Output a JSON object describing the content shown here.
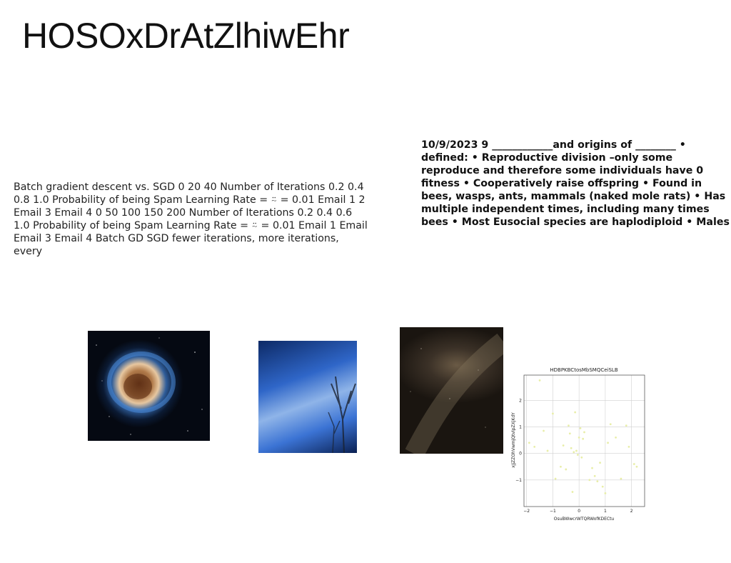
{
  "page": {
    "title": "HOSOxDrAtZlhiwEhr",
    "left_text": "Batch gradient descent vs. SGD 0 20 40 Number of Iterations 0.2 0.4 0.8 1.0 Probability of being Spam Learning Rate = ⍨ = 0.01 Email 1 2 Email 3 Email 4 0 50 100 150 200 Number of Iterations 0.2 0.4 0.6 1.0 Probability of being Spam Learning Rate = ⍨ = 0.01 Email 1 Email Email 3 Email 4 Batch GD SGD fewer iterations, more iterations, every",
    "right_text": "10/9/2023 9 ____________and origins of ________ •\ndefined: • Reproductive division –only some\nreproduce and therefore some individuals have 0\nfitness • Cooperatively raise offspring • Found in\nbees, wasps, ants, mammals (naked mole rats) • Has\nmultiple independent times, including many times\nbees • Most Eusocial species are haplodiploid • Males"
  },
  "chart_data": {
    "type": "scatter",
    "title": "HDBPKBCtosMbSMQCeiSLB",
    "xlabel": "OsuBWwcrWTQRWofKDECtu",
    "ylabel": "xJjZZOhVwmjQtvlpZXjKdY",
    "xlim": [
      -2.1,
      2.5
    ],
    "ylim": [
      -2.0,
      2.95
    ],
    "xticks": [
      -2,
      -1,
      0,
      1,
      2
    ],
    "yticks": [
      -1,
      0,
      1,
      2
    ],
    "grid": true,
    "point_color": "#e8eea8",
    "x": [
      -1.9,
      -1.7,
      -1.5,
      -1.35,
      -1.2,
      -1.0,
      -0.9,
      -0.7,
      -0.6,
      -0.5,
      -0.4,
      -0.35,
      -0.3,
      -0.25,
      -0.2,
      -0.15,
      -0.1,
      -0.05,
      0.0,
      0.05,
      0.1,
      0.15,
      0.2,
      0.4,
      0.5,
      0.6,
      0.7,
      0.8,
      0.9,
      1.0,
      1.1,
      1.2,
      1.4,
      1.6,
      1.8,
      1.9,
      2.1,
      2.2
    ],
    "y": [
      0.4,
      0.25,
      2.75,
      0.85,
      0.1,
      1.5,
      -0.95,
      -0.5,
      0.3,
      -0.6,
      1.05,
      0.75,
      0.2,
      -1.45,
      0.05,
      1.55,
      0.1,
      -0.05,
      0.6,
      0.95,
      -0.15,
      0.55,
      0.8,
      -1.0,
      -0.55,
      -0.85,
      -1.05,
      -0.35,
      -1.25,
      -1.5,
      0.4,
      1.1,
      0.6,
      -0.95,
      1.05,
      0.25,
      -0.4,
      -0.5
    ]
  }
}
